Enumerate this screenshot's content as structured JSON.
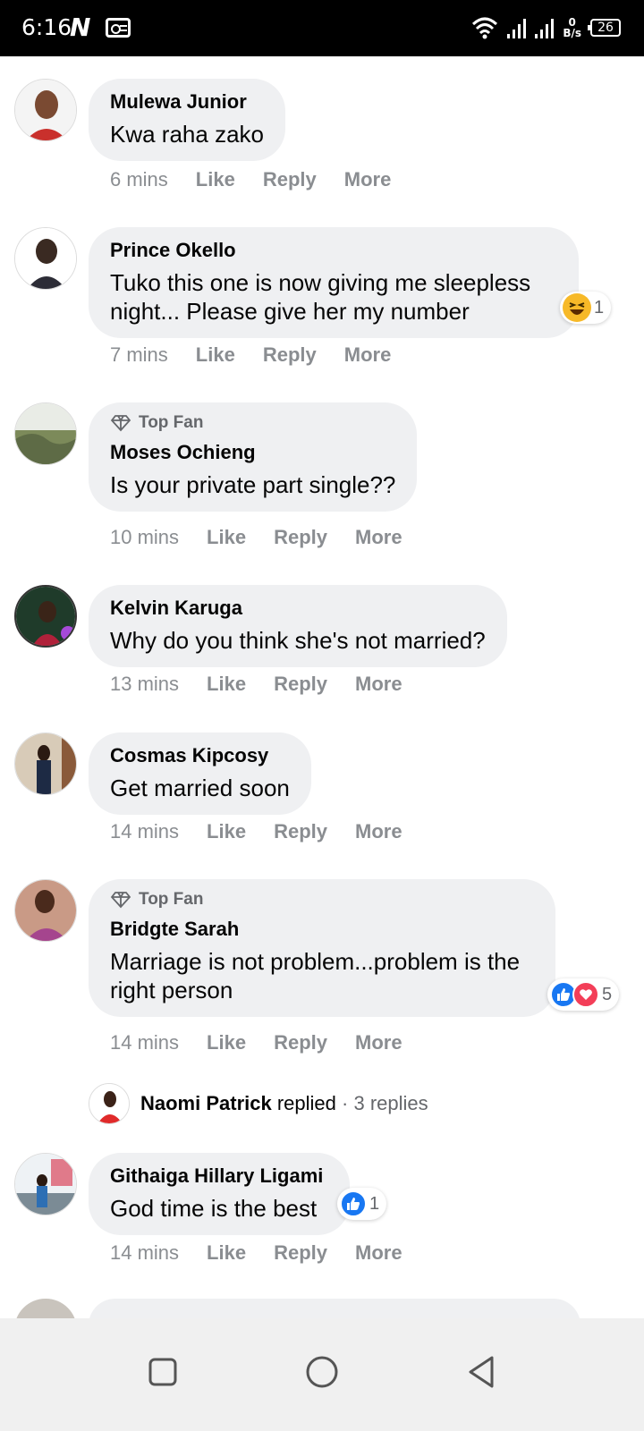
{
  "status_bar": {
    "time": "6:16",
    "carrier_glyph": "N",
    "speed_value": "0",
    "speed_unit": "B/s",
    "battery": "26"
  },
  "comments": [
    {
      "author": "Mulewa Junior",
      "text": "Kwa raha zako",
      "time": "6 mins",
      "like": "Like",
      "reply": "Reply",
      "more": "More"
    },
    {
      "author": "Prince Okello",
      "text": "Tuko this one is now giving me sleepless night... Please give her my number",
      "time": "7 mins",
      "like": "Like",
      "reply": "Reply",
      "more": "More",
      "reaction_count": "1",
      "reaction_icon": "haha-icon"
    },
    {
      "badge": "Top Fan",
      "author": "Moses Ochieng",
      "text": "Is your private part single??",
      "time": "10 mins",
      "like": "Like",
      "reply": "Reply",
      "more": "More"
    },
    {
      "author": "Kelvin Karuga",
      "text": "Why do you think she's not married?",
      "time": "13 mins",
      "like": "Like",
      "reply": "Reply",
      "more": "More"
    },
    {
      "author": "Cosmas Kipcosy",
      "text": "Get married soon",
      "time": "14 mins",
      "like": "Like",
      "reply": "Reply",
      "more": "More"
    },
    {
      "badge": "Top Fan",
      "author": "Bridgte Sarah",
      "text": "Marriage is not problem...problem is the right person",
      "time": "14 mins",
      "like": "Like",
      "reply": "Reply",
      "more": "More",
      "reaction_count": "5",
      "reaction_icon": "like-love-icons"
    },
    {
      "author": "Githaiga Hillary Ligami",
      "text": "God time is the best",
      "time": "14 mins",
      "like": "Like",
      "reply": "Reply",
      "more": "More",
      "reaction_count": "1",
      "reaction_icon": "like-icon"
    }
  ],
  "replies_link": {
    "name": "Naomi Patrick",
    "verb": "replied",
    "count": "· 3 replies"
  },
  "colors": {
    "bubble": "#eff0f2",
    "muted": "#8a8d91",
    "like_blue": "#1877f2",
    "love_red": "#f33e58"
  }
}
